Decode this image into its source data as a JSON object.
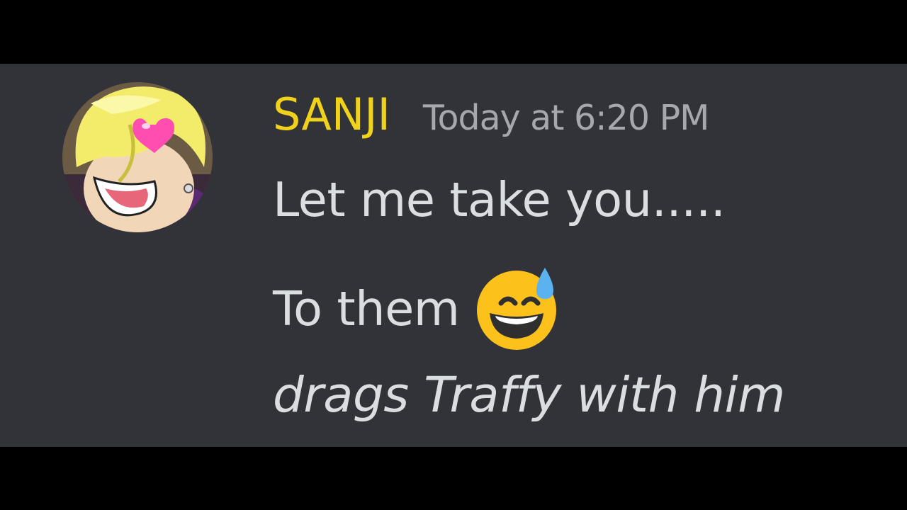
{
  "message": {
    "author": {
      "name": "SANJI",
      "name_color": "#f0d21a",
      "avatar": "sanji-heart-eyes-avatar"
    },
    "timestamp": "Today at 6:20 PM",
    "lines": [
      "Let me take you.....",
      "To them",
      "drags Traffy with him"
    ],
    "emoji": "grinning-face-with-sweat"
  },
  "colors": {
    "background": "#313338",
    "text": "#dbdee1",
    "timestamp": "#a5a8ae",
    "letterbox": "#000000"
  }
}
